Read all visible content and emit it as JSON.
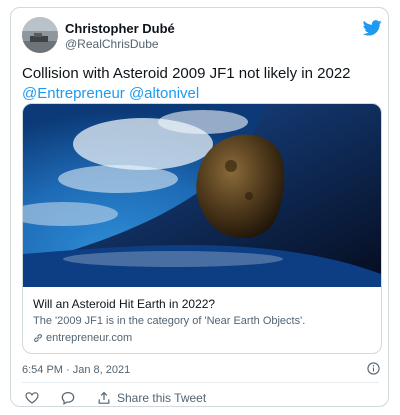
{
  "author": {
    "name": "Christopher Dubé",
    "handle": "@RealChrisDube"
  },
  "tweet": {
    "text": "Collision with Asteroid 2009 JF1 not likely in 2022",
    "mentions": [
      "@Entrepreneur",
      "@altonivel"
    ]
  },
  "card": {
    "title": "Will an Asteroid Hit Earth in 2022?",
    "description": "The '2009 JF1 is in the category of 'Near Earth Objects'.",
    "domain": "entrepreneur.com",
    "image_icon": "asteroid-earth-photo"
  },
  "timestamp": "6:54 PM · Jan 8, 2021",
  "actions": {
    "share_label": "Share this Tweet"
  },
  "icons": [
    "twitter-bird-icon",
    "link-icon",
    "info-icon",
    "heart-icon",
    "reply-icon",
    "retweet-icon",
    "share-icon"
  ],
  "colors": {
    "accent": "#1d9bf0",
    "text": "#0f1419",
    "secondary": "#536471",
    "border": "#cfd9de"
  }
}
